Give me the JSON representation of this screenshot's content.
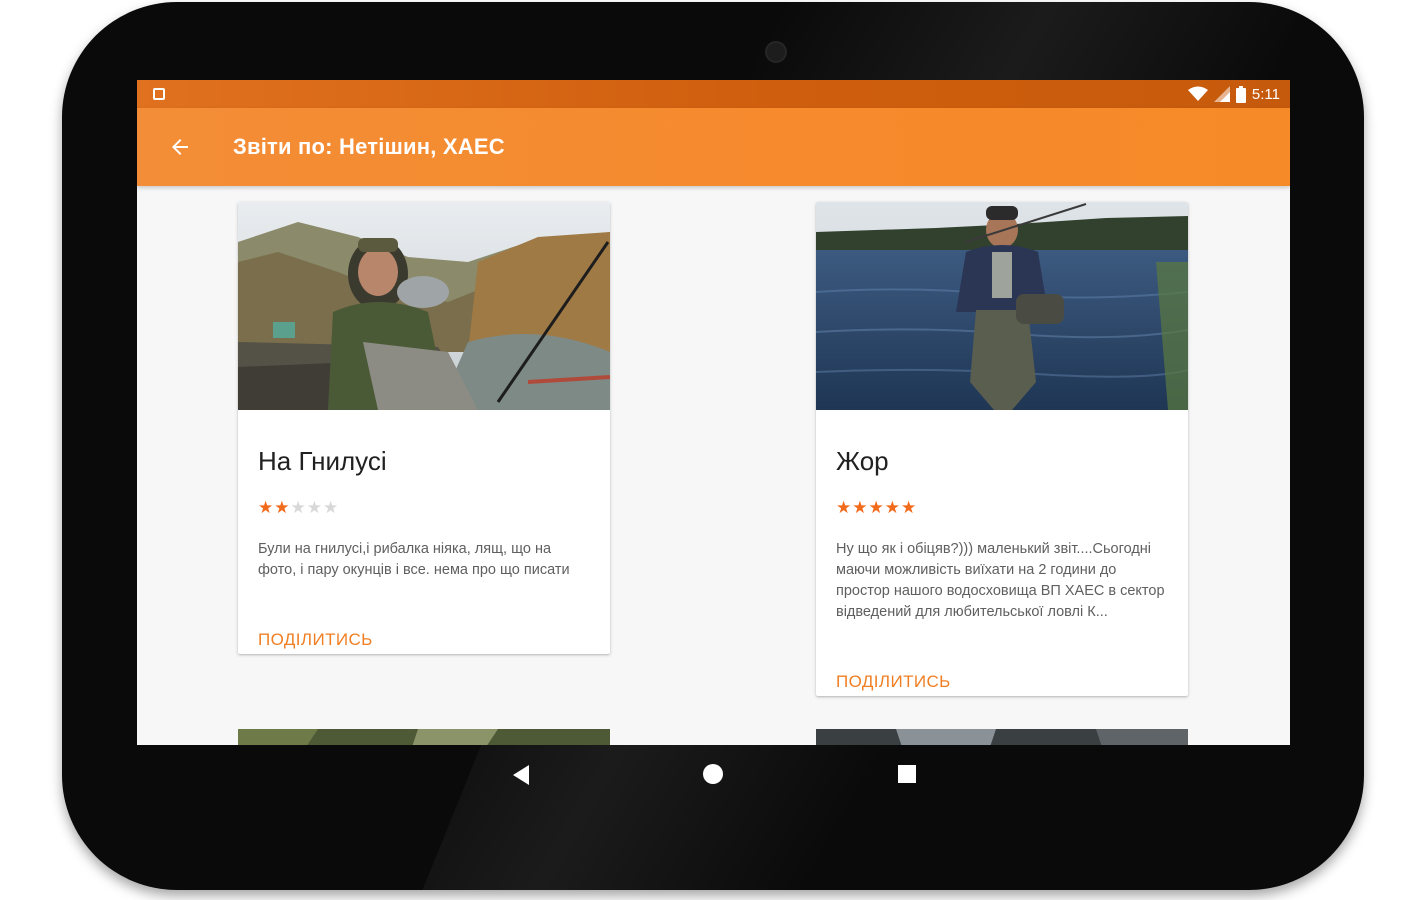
{
  "status_bar": {
    "time": "5:11",
    "icons": [
      "notification-icon",
      "wifi-icon",
      "signal-icon",
      "battery-icon"
    ]
  },
  "app_bar": {
    "title": "Звіти по: Нетішин, ХАЕС",
    "back_icon": "arrow-back-icon"
  },
  "colors": {
    "accent": "#f78a28",
    "status_bar": "#cf5f0e",
    "star_active": "#f26a1b",
    "star_inactive": "#d8d8d8",
    "share_link": "#f07f24"
  },
  "reports": [
    {
      "title": "На Гнилусі",
      "rating": 2,
      "max_rating": 5,
      "text": "Були на гнилусі,і рибалка ніяка, лящ, що на фото, і пару окунців і все. нема про що писати",
      "share_label": "ПОДІЛИТИСЬ"
    },
    {
      "title": "Жор",
      "rating": 5,
      "max_rating": 5,
      "text": "Ну що як і обіцяв?))) маленький звіт....Сьогодні маючи можливість виїхати на 2 години до простор нашого водосховища ВП ХАЕС в сектор відведений для любительської ловлі К...",
      "share_label": "ПОДІЛИТИСЬ"
    }
  ],
  "nav_bar": {
    "icons": [
      "nav-back-icon",
      "nav-home-icon",
      "nav-recents-icon"
    ]
  }
}
